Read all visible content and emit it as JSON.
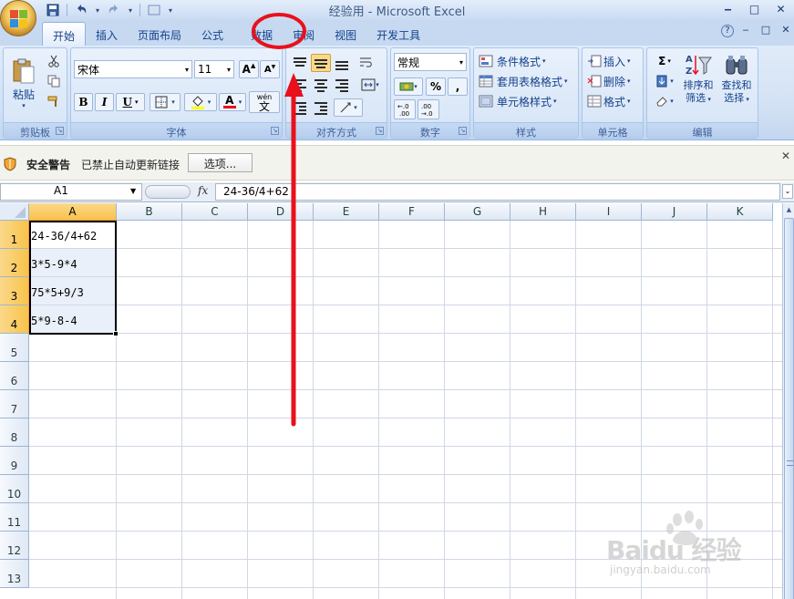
{
  "window": {
    "title": "经验用 - Microsoft Excel",
    "controls": {
      "minimize": "‒",
      "maximize": "□",
      "close": "✕"
    },
    "doc_controls": {
      "help": "?",
      "minimize": "‒",
      "restore": "□",
      "close": "✕"
    }
  },
  "quick_access": {
    "save_icon": "save-icon",
    "undo_icon": "undo-icon",
    "redo_icon": "redo-icon",
    "customize_icon": "customize-icon"
  },
  "tabs": [
    {
      "label": "开始",
      "active": true
    },
    {
      "label": "插入",
      "active": false
    },
    {
      "label": "页面布局",
      "active": false
    },
    {
      "label": "公式",
      "active": false
    },
    {
      "label": "数据",
      "active": false
    },
    {
      "label": "审阅",
      "active": false
    },
    {
      "label": "视图",
      "active": false
    },
    {
      "label": "开发工具",
      "active": false
    }
  ],
  "ribbon": {
    "clipboard": {
      "label": "剪贴板",
      "paste": "粘贴"
    },
    "font": {
      "label": "字体",
      "font_name": "宋体",
      "font_size": "11",
      "bold": "B",
      "italic": "I",
      "underline": "U",
      "grow": "A",
      "shrink": "A",
      "wen": "wén",
      "wen_char": "文",
      "font_color_letter": "A"
    },
    "alignment": {
      "label": "对齐方式"
    },
    "number": {
      "label": "数字",
      "format": "常规",
      "percent": "%",
      "comma": ",",
      "inc_decimal": "←.0 .00",
      "dec_decimal": ".00 →.0"
    },
    "styles": {
      "label": "样式",
      "conditional": "条件格式",
      "table": "套用表格格式",
      "cell_styles": "单元格样式"
    },
    "cells": {
      "label": "单元格",
      "insert": "插入",
      "delete": "删除",
      "format": "格式"
    },
    "editing": {
      "label": "编辑",
      "sigma": "Σ",
      "sort": [
        "排序和",
        "筛选"
      ],
      "find": [
        "查找和",
        "选择"
      ]
    }
  },
  "security_bar": {
    "title": "安全警告",
    "message": "已禁止自动更新链接",
    "options_button": "选项...",
    "close": "✕"
  },
  "formula_bar": {
    "name_box": "A1",
    "fx": "fx",
    "formula": "24-36/4+62"
  },
  "sheet": {
    "columns": [
      "A",
      "B",
      "C",
      "D",
      "E",
      "F",
      "G",
      "H",
      "I",
      "J",
      "K"
    ],
    "rows": [
      "1",
      "2",
      "3",
      "4",
      "5",
      "6",
      "7",
      "8",
      "9",
      "10",
      "11",
      "12",
      "13"
    ],
    "cells": [
      {
        "ref": "A1",
        "value": "24-36/4+62"
      },
      {
        "ref": "A2",
        "value": "3*5-9*4"
      },
      {
        "ref": "A3",
        "value": "75*5+9/3"
      },
      {
        "ref": "A4",
        "value": "5*9-8-4"
      }
    ],
    "active_cell": "A1",
    "selected_columns": [
      "A"
    ],
    "selected_rows": [
      "1",
      "2",
      "3",
      "4"
    ]
  },
  "annotation": {
    "color": "#e8111c",
    "target_tab": "数据"
  },
  "watermark": {
    "logo_text": "Baidu 经验",
    "url": "jingyan.baidu.com"
  }
}
